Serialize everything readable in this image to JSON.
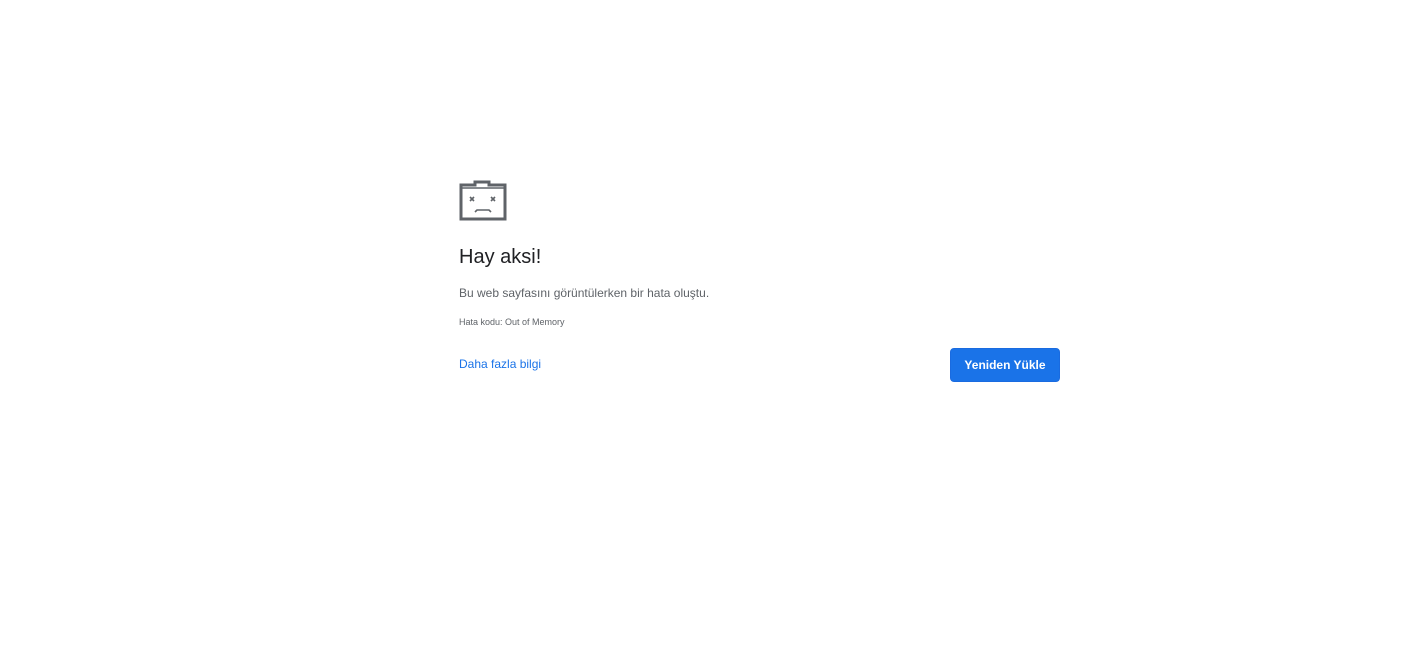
{
  "error": {
    "icon": "sad-tab-icon",
    "title": "Hay aksi!",
    "description": "Bu web sayfasını görüntülerken bir hata oluştu.",
    "code_text": "Hata kodu: Out of Memory"
  },
  "actions": {
    "details_link": "Daha fazla bilgi",
    "reload_button": "Yeniden Yükle"
  },
  "colors": {
    "accent": "#1a73e8",
    "title_text": "#202124",
    "secondary_text": "#5f6368",
    "icon": "#5f6368"
  }
}
